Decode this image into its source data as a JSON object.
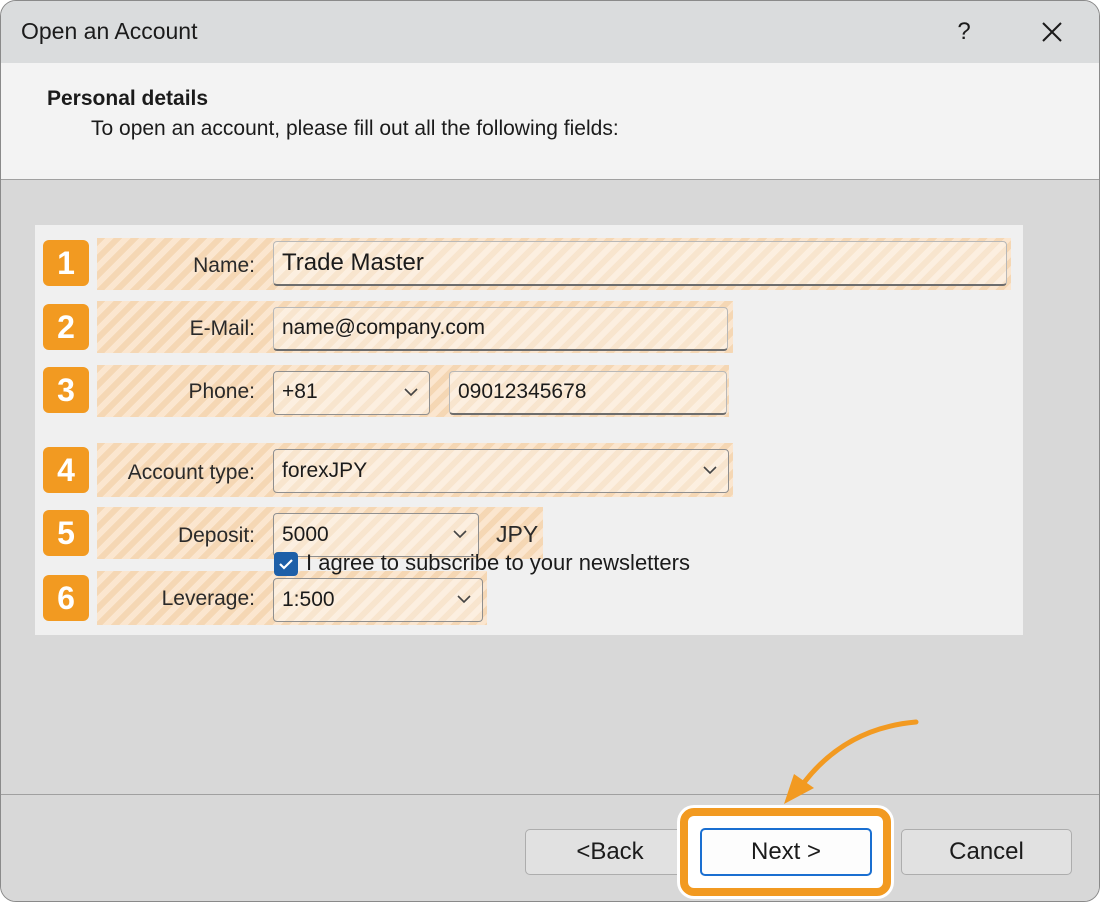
{
  "window": {
    "title": "Open an Account",
    "help_glyph": "?",
    "accent": "#f29a21",
    "focus_blue": "#1a6fd1"
  },
  "header": {
    "title": "Personal details",
    "subtitle": "To open an account, please fill out all the following fields:"
  },
  "form": {
    "name": {
      "badge": "1",
      "label": "Name:",
      "value": "Trade Master"
    },
    "email": {
      "badge": "2",
      "label": "E-Mail:",
      "value": "name@company.com"
    },
    "phone": {
      "badge": "3",
      "label": "Phone:",
      "code": "+81",
      "number": "09012345678"
    },
    "account_type": {
      "badge": "4",
      "label": "Account type:",
      "value": "forexJPY"
    },
    "deposit": {
      "badge": "5",
      "label": "Deposit:",
      "value": "5000",
      "currency": "JPY"
    },
    "leverage": {
      "badge": "6",
      "label": "Leverage:",
      "value": "1:500"
    }
  },
  "newsletter": {
    "label": "I agree to subscribe to your newsletters",
    "checked": true
  },
  "buttons": {
    "back": "<Back",
    "next": "Next >",
    "cancel": "Cancel"
  },
  "icons": {
    "help": "help-icon",
    "close": "close-icon",
    "chevron": "chevron-down-icon",
    "check": "check-icon"
  }
}
